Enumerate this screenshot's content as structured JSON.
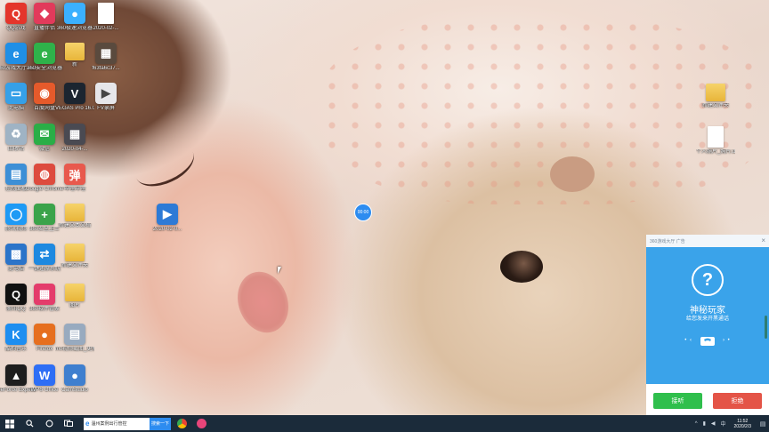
{
  "desktop": {
    "icons": [
      {
        "label": "QQ游戏",
        "glyph": "Q",
        "color": "#e4352b"
      },
      {
        "label": "直播伴侣",
        "glyph": "◆",
        "color": "#e23a5b"
      },
      {
        "label": "360极速浏览器",
        "glyph": "●",
        "color": "#3bb0ff"
      },
      {
        "label": "2020-02-...",
        "glyph": "",
        "color": "#ffffff"
      },
      {
        "label": "360游戏大厅-五家客户端",
        "glyph": "e",
        "color": "#1f8fe6"
      },
      {
        "label": "360安全浏览器",
        "glyph": "e",
        "color": "#2fb24a"
      },
      {
        "label": "新",
        "glyph": "",
        "color": "#e8b53a"
      },
      {
        "label": "f63fa6c37...",
        "glyph": "▦",
        "color": "#5a4a3e"
      },
      {
        "label": "此电脑",
        "glyph": "▭",
        "color": "#35a0e8"
      },
      {
        "label": "百度网盘",
        "glyph": "◉",
        "color": "#e55a2b"
      },
      {
        "label": "VEGAS Pro 16.0",
        "glyph": "V",
        "color": "#1c2530"
      },
      {
        "label": "FV录屏",
        "glyph": "▶",
        "color": "#e6e6ea"
      },
      {
        "label": "回收站",
        "glyph": "♻",
        "color": "#9fb3c4"
      },
      {
        "label": "微信",
        "glyph": "✉",
        "color": "#2aae47"
      },
      {
        "label": "2020-04-...",
        "glyph": "▦",
        "color": "#4a4a52"
      },
      {
        "label": "控制面板",
        "glyph": "▤",
        "color": "#3d8fd6"
      },
      {
        "label": "Google Chrome",
        "glyph": "◍",
        "color": "#dd4b3e"
      },
      {
        "label": "哔哩哔哩",
        "glyph": "弹",
        "color": "#e8594d"
      },
      {
        "label": "腾讯视频",
        "glyph": "◯",
        "color": "#1e9af5"
      },
      {
        "label": "360安全卫士",
        "glyph": "+",
        "color": "#3ba34a"
      },
      {
        "label": "新建文本文档",
        "glyph": "",
        "color": "#f4c653"
      },
      {
        "label": "2020-02-0...",
        "glyph": "▶",
        "color": "#2d7ad6"
      },
      {
        "label": "此电脑",
        "glyph": "▩",
        "color": "#2b74c9"
      },
      {
        "label": "一键还原系统",
        "glyph": "⇄",
        "color": "#1e89e0"
      },
      {
        "label": "新建文件夹",
        "glyph": "",
        "color": "#f4c653"
      },
      {
        "label": "腾讯QQ",
        "glyph": "Q",
        "color": "#111111"
      },
      {
        "label": "360软件管家",
        "glyph": "▦",
        "color": "#e43c6b"
      },
      {
        "label": "图片",
        "glyph": "",
        "color": "#e8b53a"
      },
      {
        "label": "酷狗音乐",
        "glyph": "K",
        "color": "#1e8ef0"
      },
      {
        "label": "Firefox",
        "glyph": "●",
        "color": "#e66f1f"
      },
      {
        "label": "mv视频截图_更新",
        "glyph": "▤",
        "color": "#98aabf"
      },
      {
        "label": "GeForce Experience",
        "glyph": "▲",
        "color": "#1e1e1e"
      },
      {
        "label": "WPS Office",
        "glyph": "W",
        "color": "#2e6ef5"
      },
      {
        "label": "CamStudio",
        "glyph": "●",
        "color": "#3f7fcf"
      },
      {
        "label": "新建文件夹",
        "glyph": "",
        "color": "#e8b53a"
      },
      {
        "label": "个人照片_照片.docx",
        "glyph": "",
        "color": "#ffffff"
      }
    ],
    "timer_bubble": "00:00"
  },
  "popup": {
    "title": "360游戏大厅  广告",
    "close_glyph": "×",
    "caller_name": "神秘玩家",
    "caller_sub": "给您发来开黑通话",
    "accept_label": "接听",
    "reject_label": "拒绝"
  },
  "taskbar": {
    "search_value": "温州案例出行管控",
    "search_button": "搜索一下",
    "time": "11:52",
    "date": "2020/2/3"
  }
}
